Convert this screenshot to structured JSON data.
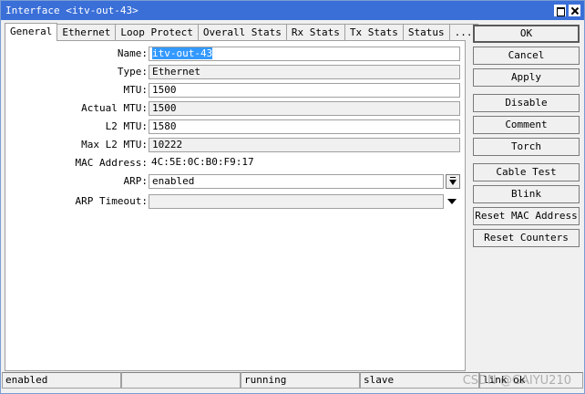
{
  "window": {
    "title": "Interface <itv-out-43>"
  },
  "tabs": [
    {
      "label": "General"
    },
    {
      "label": "Ethernet"
    },
    {
      "label": "Loop Protect"
    },
    {
      "label": "Overall Stats"
    },
    {
      "label": "Rx Stats"
    },
    {
      "label": "Tx Stats"
    },
    {
      "label": "Status"
    },
    {
      "label": "..."
    }
  ],
  "general": {
    "name": {
      "label": "Name:",
      "value": "itv-out-43"
    },
    "type": {
      "label": "Type:",
      "value": "Ethernet"
    },
    "mtu": {
      "label": "MTU:",
      "value": "1500"
    },
    "actual_mtu": {
      "label": "Actual MTU:",
      "value": "1500"
    },
    "l2_mtu": {
      "label": "L2 MTU:",
      "value": "1580"
    },
    "max_l2_mtu": {
      "label": "Max L2 MTU:",
      "value": "10222"
    },
    "mac_address": {
      "label": "MAC Address:",
      "value": "4C:5E:0C:B0:F9:17"
    },
    "arp": {
      "label": "ARP:",
      "value": "enabled"
    },
    "arp_timeout": {
      "label": "ARP Timeout:",
      "value": ""
    }
  },
  "buttons": {
    "ok": "OK",
    "cancel": "Cancel",
    "apply": "Apply",
    "disable": "Disable",
    "comment": "Comment",
    "torch": "Torch",
    "cable_test": "Cable Test",
    "blink": "Blink",
    "reset_mac": "Reset MAC Address",
    "reset_counters": "Reset Counters"
  },
  "status": {
    "cells": [
      "enabled",
      "",
      "running",
      "slave",
      "link ok"
    ]
  },
  "watermark": "CSDN @GAIYU210"
}
